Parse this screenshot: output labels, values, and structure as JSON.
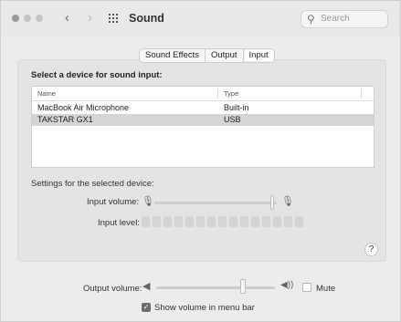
{
  "window": {
    "title": "Sound"
  },
  "toolbar": {
    "search_placeholder": "Search"
  },
  "tabs": [
    {
      "label": "Sound Effects",
      "selected": false
    },
    {
      "label": "Output",
      "selected": false
    },
    {
      "label": "Input",
      "selected": true
    }
  ],
  "input_panel": {
    "select_label": "Select a device for sound input:",
    "columns": [
      "Name",
      "Type"
    ],
    "devices": [
      {
        "name": "MacBook Air Microphone",
        "type": "Built-in",
        "selected": false
      },
      {
        "name": "TAKSTAR GX1",
        "type": "USB",
        "selected": true
      }
    ],
    "settings_label": "Settings for the selected device:",
    "input_volume_label": "Input volume:",
    "input_volume_fraction": 0.96,
    "input_level_label": "Input level:",
    "input_level_segments_lit": 0,
    "input_level_segments_total": 15,
    "help_label": "?"
  },
  "footer": {
    "output_volume_label": "Output volume:",
    "output_volume_fraction": 0.73,
    "mute_label": "Mute",
    "mute_checked": false,
    "show_volume_label": "Show volume in menu bar",
    "show_volume_checked": true
  },
  "icons": {
    "back": "chevron-left-icon",
    "forward": "chevron-right-icon",
    "grid": "grid-icon",
    "search": "search-icon",
    "mic_low": "microphone-low-icon",
    "mic_high": "microphone-high-icon",
    "speaker_low": "speaker-low-icon",
    "speaker_high": "speaker-high-icon"
  }
}
